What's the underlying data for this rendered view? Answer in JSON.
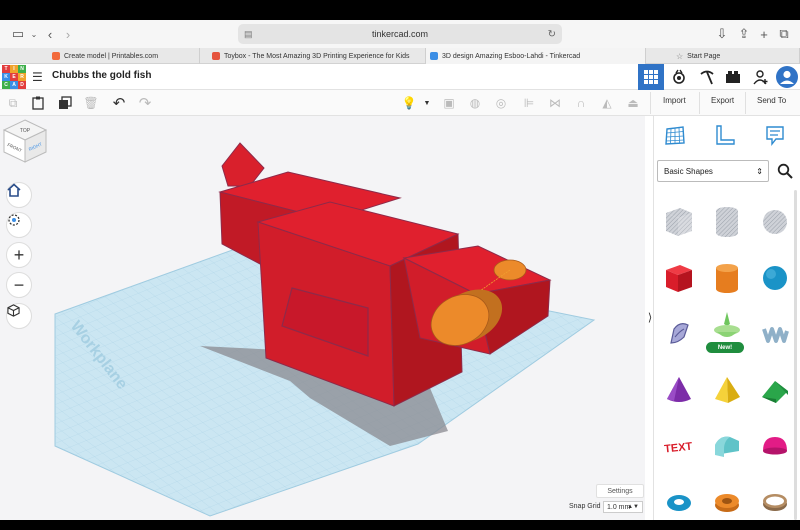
{
  "browser": {
    "url": "tinkercad.com",
    "tabs": [
      {
        "label": "Create model | Printables.com",
        "favicon_color": "#f26a3b",
        "active": false
      },
      {
        "label": "Toybox - The Most Amazing 3D Printing Experience for Kids",
        "favicon_color": "#e5533d",
        "active": false
      },
      {
        "label": "3D design Amazing Esboo-Lahdi - Tinkercad",
        "favicon_color": "#3b8ee5",
        "active": true
      },
      {
        "label": "Start Page",
        "favicon_color": "#999999",
        "active": false
      }
    ]
  },
  "app": {
    "logo_letters": [
      "TIN",
      "KER",
      "CAD"
    ],
    "design_title": "Chubbs the gold fish",
    "header_buttons": [
      "grid-view-icon",
      "community-icon",
      "pickaxe-icon",
      "lego-brick-icon",
      "add-user-icon",
      "profile-avatar-icon"
    ]
  },
  "toolbar": {
    "import_label": "Import",
    "export_label": "Export",
    "send_to_label": "Send To"
  },
  "viewport": {
    "workplane_label": "Workplane",
    "viewcube_faces": {
      "top": "TOP",
      "front": "FRONT",
      "right": "RIGHT"
    },
    "settings_label": "Settings",
    "snap_grid_label": "Snap Grid",
    "snap_grid_value": "1.0 mm"
  },
  "panel": {
    "category_value": "Basic Shapes",
    "new_badge": "New!",
    "shapes": [
      "box-hole",
      "cylinder-hole",
      "sphere-hole",
      "box",
      "cylinder",
      "sphere",
      "scribble",
      "spinner",
      "text-squiggle",
      "cone",
      "pyramid",
      "roof",
      "text",
      "half-cylinder",
      "half-sphere",
      "torus",
      "tube",
      "ring"
    ]
  },
  "colors": {
    "accent": "#3073c6",
    "shape_red": "#e0202e",
    "shape_orange": "#ec8a2a",
    "workplane": "#cbe6f2"
  }
}
